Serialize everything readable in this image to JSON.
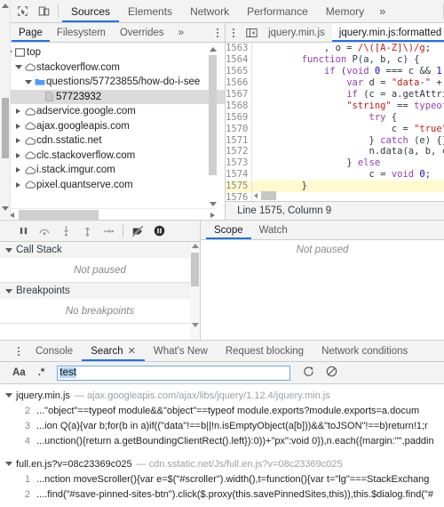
{
  "main_tabs": {
    "inspect_icon": "inspect-cursor-icon",
    "device_icon": "device-toolbar-icon",
    "items": [
      {
        "label": "Sources",
        "active": true
      },
      {
        "label": "Elements",
        "active": false
      },
      {
        "label": "Network",
        "active": false
      },
      {
        "label": "Performance",
        "active": false
      },
      {
        "label": "Memory",
        "active": false
      }
    ],
    "more_label": "»"
  },
  "navigator": {
    "tabs": [
      {
        "label": "Page",
        "active": true
      },
      {
        "label": "Filesystem",
        "active": false
      },
      {
        "label": "Overrides",
        "active": false
      },
      {
        "label": "»",
        "active": false
      }
    ],
    "tree": [
      {
        "label": "top",
        "indent": 0,
        "arrow": "open",
        "icon": "frame-icon",
        "selected": false
      },
      {
        "label": "stackoverflow.com",
        "indent": 1,
        "arrow": "open",
        "icon": "cloud-icon",
        "selected": false
      },
      {
        "label": "questions/57723855/how-do-i-see",
        "indent": 2,
        "arrow": "open",
        "icon": "folder-icon",
        "selected": false
      },
      {
        "label": "57723932",
        "indent": 3,
        "arrow": "none",
        "icon": "file-icon",
        "selected": true
      },
      {
        "label": "adservice.google.com",
        "indent": 1,
        "arrow": "closed",
        "icon": "cloud-icon",
        "selected": false
      },
      {
        "label": "ajax.googleapis.com",
        "indent": 1,
        "arrow": "closed",
        "icon": "cloud-icon",
        "selected": false
      },
      {
        "label": "cdn.sstatic.net",
        "indent": 1,
        "arrow": "closed",
        "icon": "cloud-icon",
        "selected": false
      },
      {
        "label": "clc.stackoverflow.com",
        "indent": 1,
        "arrow": "closed",
        "icon": "cloud-icon",
        "selected": false
      },
      {
        "label": "i.stack.imgur.com",
        "indent": 1,
        "arrow": "closed",
        "icon": "cloud-icon",
        "selected": false
      },
      {
        "label": "pixel.quantserve.com",
        "indent": 1,
        "arrow": "closed",
        "icon": "cloud-icon",
        "selected": false
      }
    ]
  },
  "editor": {
    "panel_icon": "show-navigator-icon",
    "tabs": [
      {
        "label": "jquery.min.js",
        "active": false
      },
      {
        "label": "jquery.min.js:formatted",
        "active": true
      }
    ],
    "lines": [
      {
        "no": "1563",
        "highlight": false,
        "tokens": [
          {
            "t": "            , o = ",
            "c": "pln"
          },
          {
            "t": "/\\([A-Z]\\)/g",
            "c": "str"
          },
          {
            "t": ";",
            "c": "pln"
          }
        ]
      },
      {
        "no": "1564",
        "highlight": false,
        "tokens": [
          {
            "t": "        ",
            "c": "pln"
          },
          {
            "t": "function",
            "c": "kw"
          },
          {
            "t": " P(a, b, c) {",
            "c": "pln"
          }
        ]
      },
      {
        "no": "1565",
        "highlight": false,
        "tokens": [
          {
            "t": "            ",
            "c": "pln"
          },
          {
            "t": "if",
            "c": "kw"
          },
          {
            "t": " (",
            "c": "pln"
          },
          {
            "t": "void",
            "c": "kw"
          },
          {
            "t": " ",
            "c": "pln"
          },
          {
            "t": "0",
            "c": "num"
          },
          {
            "t": " === c && ",
            "c": "pln"
          },
          {
            "t": "1",
            "c": "num"
          },
          {
            "t": " ==",
            "c": "pln"
          }
        ]
      },
      {
        "no": "1566",
        "highlight": false,
        "tokens": [
          {
            "t": "                ",
            "c": "pln"
          },
          {
            "t": "var",
            "c": "kw"
          },
          {
            "t": " d = ",
            "c": "pln"
          },
          {
            "t": "\"data-\"",
            "c": "str"
          },
          {
            "t": " + b.",
            "c": "pln"
          }
        ]
      },
      {
        "no": "1567",
        "highlight": false,
        "tokens": [
          {
            "t": "                ",
            "c": "pln"
          },
          {
            "t": "if",
            "c": "kw"
          },
          {
            "t": " (c = a.getAttribu",
            "c": "pln"
          }
        ]
      },
      {
        "no": "1568",
        "highlight": false,
        "tokens": [
          {
            "t": "                ",
            "c": "pln"
          },
          {
            "t": "\"string\"",
            "c": "str"
          },
          {
            "t": " == ",
            "c": "pln"
          },
          {
            "t": "typeof",
            "c": "kw"
          },
          {
            "t": " c",
            "c": "pln"
          }
        ]
      },
      {
        "no": "1569",
        "highlight": false,
        "tokens": [
          {
            "t": "                    ",
            "c": "pln"
          },
          {
            "t": "try",
            "c": "kw"
          },
          {
            "t": " {",
            "c": "pln"
          }
        ]
      },
      {
        "no": "1570",
        "highlight": false,
        "tokens": [
          {
            "t": "                        c = ",
            "c": "pln"
          },
          {
            "t": "\"true\"",
            "c": "str"
          },
          {
            "t": " =",
            "c": "pln"
          }
        ]
      },
      {
        "no": "1571",
        "highlight": false,
        "tokens": [
          {
            "t": "                    } ",
            "c": "pln"
          },
          {
            "t": "catch",
            "c": "kw"
          },
          {
            "t": " (e) {}",
            "c": "pln"
          }
        ]
      },
      {
        "no": "1572",
        "highlight": false,
        "tokens": [
          {
            "t": "                    n.data(a, b, c)",
            "c": "pln"
          }
        ]
      },
      {
        "no": "1573",
        "highlight": false,
        "tokens": [
          {
            "t": "                } ",
            "c": "pln"
          },
          {
            "t": "else",
            "c": "kw"
          }
        ]
      },
      {
        "no": "1574",
        "highlight": false,
        "tokens": [
          {
            "t": "                    c = ",
            "c": "pln"
          },
          {
            "t": "void",
            "c": "kw"
          },
          {
            "t": " ",
            "c": "pln"
          },
          {
            "t": "0",
            "c": "num"
          },
          {
            "t": ";",
            "c": "pln"
          }
        ]
      },
      {
        "no": "1575",
        "highlight": true,
        "tokens": [
          {
            "t": "        }",
            "c": "pln"
          }
        ]
      },
      {
        "no": "1576",
        "highlight": false,
        "tokens": [
          {
            "t": "",
            "c": "pln"
          }
        ]
      }
    ],
    "status": "Line 1575, Column 9"
  },
  "debugger": {
    "toolbar_icons": [
      {
        "name": "pause-script-icon"
      },
      {
        "name": "step-over-icon"
      },
      {
        "name": "step-into-icon"
      },
      {
        "name": "step-out-icon"
      },
      {
        "name": "step-icon"
      },
      {
        "name": "deactivate-breakpoints-icon"
      },
      {
        "name": "pause-on-exceptions-icon"
      }
    ],
    "sections": [
      {
        "title": "Call Stack",
        "empty": "Not paused"
      },
      {
        "title": "Breakpoints",
        "empty": "No breakpoints"
      }
    ],
    "side_tabs": [
      {
        "label": "Scope",
        "active": true
      },
      {
        "label": "Watch",
        "active": false
      }
    ],
    "side_empty": "Not paused"
  },
  "drawer": {
    "tabs": [
      {
        "label": "Console",
        "active": false,
        "closable": false
      },
      {
        "label": "Search",
        "active": true,
        "closable": true
      },
      {
        "label": "What's New",
        "active": false,
        "closable": false
      },
      {
        "label": "Request blocking",
        "active": false,
        "closable": false
      },
      {
        "label": "Network conditions",
        "active": false,
        "closable": false
      }
    ],
    "close_glyph": "✕",
    "search": {
      "match_case_label": "Aa",
      "regex_label": ".*",
      "value": "test",
      "placeholder": "",
      "refresh_icon": "refresh-icon",
      "clear_icon": "clear-icon"
    },
    "results": [
      {
        "file": "jquery.min.js",
        "dash": "—",
        "url": "ajax.googleapis.com/ajax/libs/jquery/1.12.4/jquery.min.js",
        "matches": [
          {
            "no": "2",
            "text": "...\"object\"==typeof module&&\"object\"==typeof module.exports?module.exports=a.docum"
          },
          {
            "no": "3",
            "text": "...ion Q(a){var b;for(b in a)if((\"data\"!==b||!n.isEmptyObject(a[b]))&&\"toJSON\"!==b)return!1;r"
          },
          {
            "no": "4",
            "text": "...unction(){return a.getBoundingClientRect().left}):0))+\"px\":void 0}),n.each({margin:\"\",paddin"
          }
        ]
      },
      {
        "file": "full.en.js?v=08c23369c025",
        "dash": "—",
        "url": "cdn.sstatic.net/Js/full.en.js?v=08c23369c025",
        "matches": [
          {
            "no": "1",
            "text": "...nction moveScroller(){var e=$(\"#scroller\").width(),t=function(){var t=\"lg\"===StackExchang"
          },
          {
            "no": "2",
            "text": "....find(\"#save-pinned-sites-btn\").click($.proxy(this.savePinnedSites,this)),this.$dialog.find(\"#"
          }
        ]
      }
    ]
  },
  "colors": {
    "accent": "#1a73e8",
    "highlight_line": "#fffacd",
    "selection": "#b5d6fb",
    "string": "#c41a16",
    "keyword": "#9a3bb3",
    "number": "#1c00cf"
  }
}
